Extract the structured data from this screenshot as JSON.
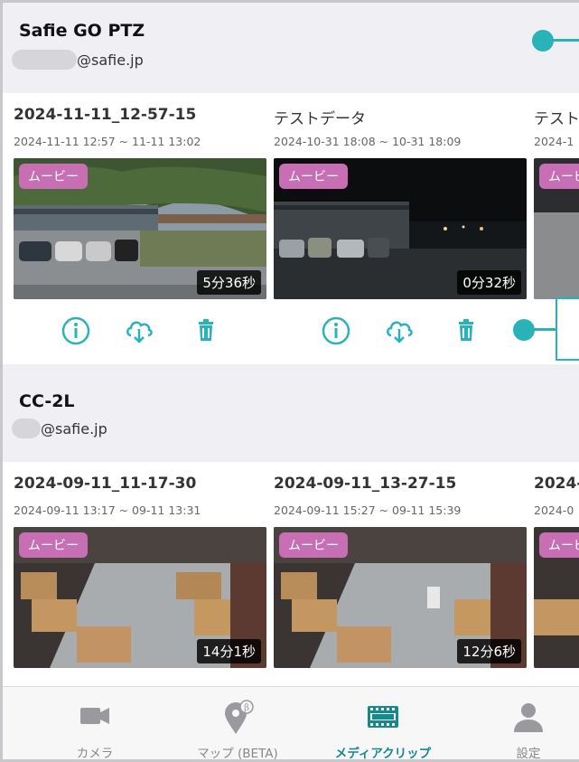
{
  "groups": [
    {
      "title": "Safie GO PTZ",
      "account": "@safie.jp",
      "clips": [
        {
          "title": "2024-11-11_12-57-15",
          "range": "2024-11-11 12:57 ~ 11-11 13:02",
          "badge": "ムービー",
          "duration": "5分36秒"
        },
        {
          "title": "テストデータ",
          "range": "2024-10-31 18:08 ~ 10-31 18:09",
          "badge": "ムービー",
          "duration": "0分32秒"
        },
        {
          "title": "テスト",
          "range": "2024-1",
          "badge": "ムービ"
        }
      ]
    },
    {
      "title": "CC-2L",
      "account": "@safie.jp",
      "clips": [
        {
          "title": "2024-09-11_11-17-30",
          "range": "2024-09-11 13:17 ~ 09-11 13:31",
          "badge": "ムービー",
          "duration": "14分1秒"
        },
        {
          "title": "2024-09-11_13-27-15",
          "range": "2024-09-11 15:27 ~ 09-11 15:39",
          "badge": "ムービー",
          "duration": "12分6秒"
        },
        {
          "title": "2024-",
          "range": "2024-0",
          "badge": "ムービ"
        }
      ]
    }
  ],
  "tabs": [
    {
      "label": "カメラ",
      "icon": "camera-icon"
    },
    {
      "label": "マップ (BETA)",
      "icon": "map-pin-icon"
    },
    {
      "label": "メディアクリップ",
      "icon": "film-icon"
    },
    {
      "label": "設定",
      "icon": "person-icon"
    }
  ],
  "colors": {
    "accent": "#29b3b8",
    "active_tab": "#16898f",
    "badge": "#c86eb4"
  }
}
